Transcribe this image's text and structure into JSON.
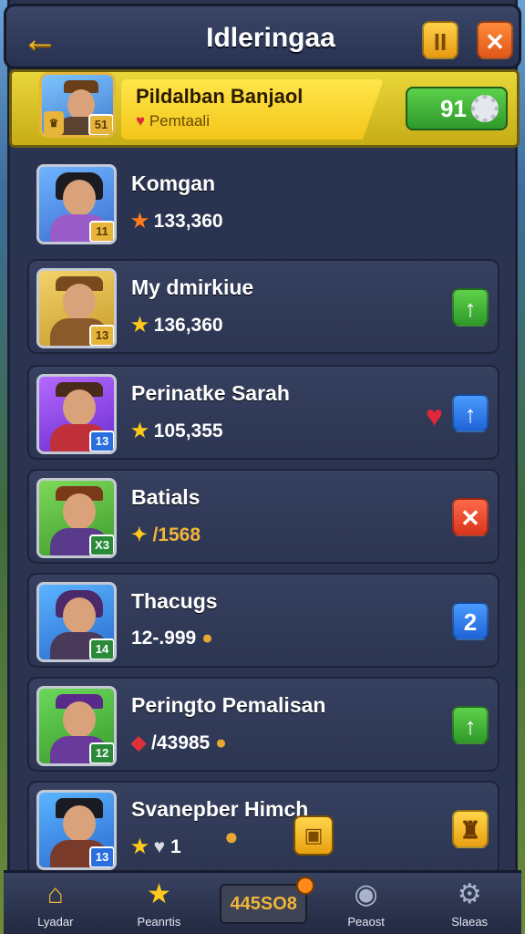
{
  "header": {
    "title": "Idleringaa",
    "back_icon": "arrow-left-icon",
    "pause_label": "II",
    "close_label": "✕"
  },
  "featured": {
    "name": "Pildalban Banjaol",
    "subtitle": "Pemtaali",
    "level": "51",
    "score": "91"
  },
  "players": [
    {
      "name": "Komgan",
      "score": "133,360",
      "level": "11",
      "score_icon": "star-icon",
      "action": "none"
    },
    {
      "name": "My dmirkiue",
      "score": "136,360",
      "level": "13",
      "score_icon": "star-icon",
      "action": "upgrade"
    },
    {
      "name": "Perinatke Sarah",
      "score": "105,355",
      "level": "13",
      "score_icon": "star-icon",
      "action": "upgrade",
      "liked": true
    },
    {
      "name": "Batials",
      "score": "/1568",
      "level": "X3",
      "score_icon": "sparkle-icon",
      "action": "remove"
    },
    {
      "name": "Thacugs",
      "score": "12-.999",
      "level": "14",
      "score_icon": "coin-icon",
      "action": "badge",
      "badge": "2"
    },
    {
      "name": "Peringto Pemalisan",
      "score": "/43985",
      "level": "12",
      "score_icon": "coin-icon",
      "action": "upgrade"
    },
    {
      "name": "Svanepber Himch",
      "score": "1",
      "level": "13",
      "score_icon": "star-icon",
      "action": "gift"
    }
  ],
  "nav": {
    "items": [
      {
        "label": "Lyadar",
        "icon": "home-icon"
      },
      {
        "label": "Peanrtis",
        "icon": "star-icon"
      },
      {
        "label": "445SO8",
        "icon": "counter"
      },
      {
        "label": "Peaost",
        "icon": "profile-icon"
      },
      {
        "label": "Slaeas",
        "icon": "gear-icon"
      }
    ]
  },
  "colors": {
    "panel": "#2a3350",
    "accent_gold": "#f2b61c",
    "accent_green": "#2e9a2a",
    "accent_blue": "#1e63d6",
    "accent_red": "#d9341c"
  }
}
